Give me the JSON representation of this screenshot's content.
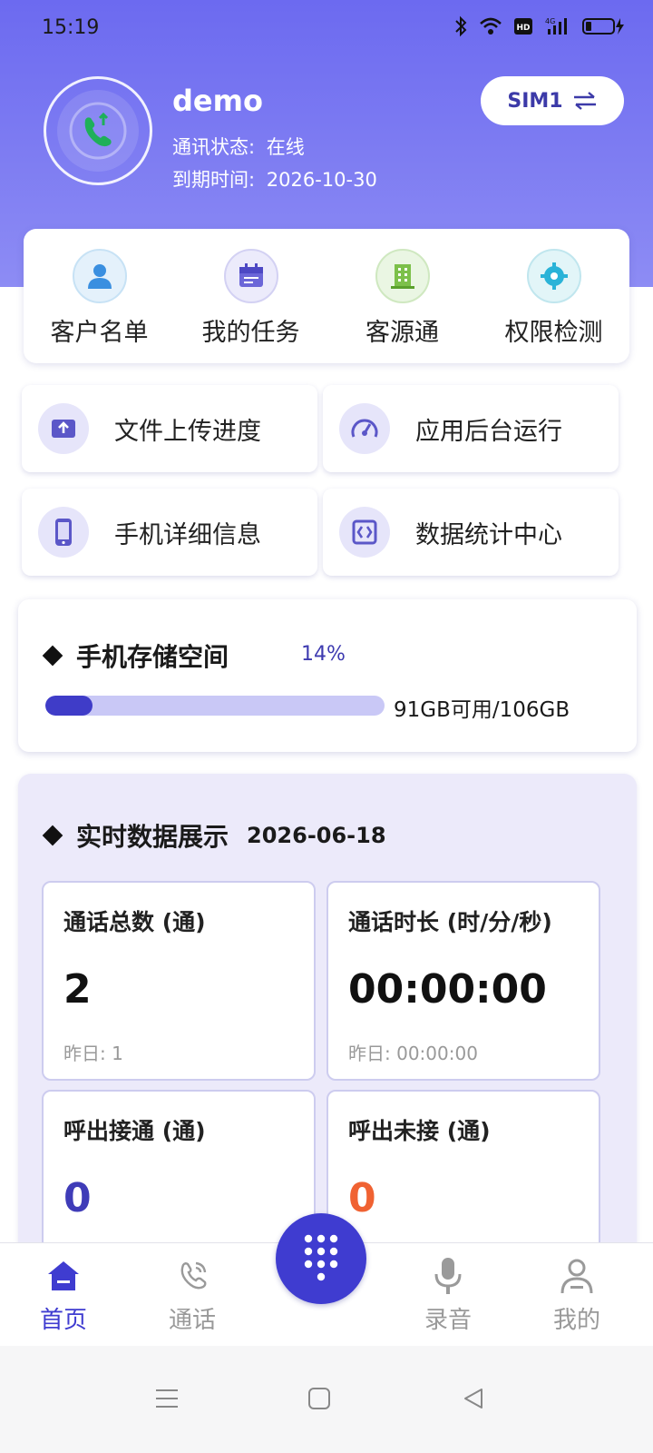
{
  "status_bar": {
    "time": "15:19",
    "icons": [
      "bluetooth-icon",
      "wifi-icon",
      "hd-icon",
      "4g-signal-icon",
      "battery-icon"
    ]
  },
  "profile": {
    "username": "demo",
    "status_label": "通讯状态:",
    "status_value": "在线",
    "expiry_label": "到期时间:",
    "expiry_value": "2026-10-30",
    "sim_button": "SIM1"
  },
  "quick_actions": [
    {
      "label": "客户名单",
      "icon": "customer-list-icon"
    },
    {
      "label": "我的任务",
      "icon": "calendar-task-icon"
    },
    {
      "label": "客源通",
      "icon": "building-icon"
    },
    {
      "label": "权限检测",
      "icon": "gear-icon"
    }
  ],
  "tiles": [
    {
      "label": "文件上传进度",
      "icon": "upload-icon"
    },
    {
      "label": "应用后台运行",
      "icon": "speedometer-icon"
    },
    {
      "label": "手机详细信息",
      "icon": "phone-icon"
    },
    {
      "label": "数据统计中心",
      "icon": "data-icon"
    }
  ],
  "storage": {
    "title": "手机存储空间",
    "percent_text": "14%",
    "percent_value": 14,
    "usage_text": "91GB可用/106GB"
  },
  "realtime": {
    "title": "实时数据展示",
    "date": "2026-06-18",
    "cards": [
      {
        "title": "通话总数 (通)",
        "value": "2",
        "sub": "昨日: 1",
        "color": "#111111"
      },
      {
        "title": "通话时长 (时/分/秒)",
        "value": "00:00:00",
        "sub": "昨日: 00:00:00",
        "color": "#111111"
      },
      {
        "title": "呼出接通 (通)",
        "value": "0",
        "sub": "",
        "color": "#3f3cb8"
      },
      {
        "title": "呼出未接 (通)",
        "value": "0",
        "sub": "",
        "color": "#f06232"
      }
    ]
  },
  "bottom_nav": [
    {
      "label": "首页",
      "icon": "home-icon",
      "active": true
    },
    {
      "label": "通话",
      "icon": "phone-call-icon",
      "active": false
    },
    {
      "label": "录音",
      "icon": "microphone-icon",
      "active": false
    },
    {
      "label": "我的",
      "icon": "user-icon",
      "active": false
    }
  ],
  "colors": {
    "accent": "#3f3cd0",
    "hero": "#6c6af0",
    "orange": "#f06232"
  }
}
